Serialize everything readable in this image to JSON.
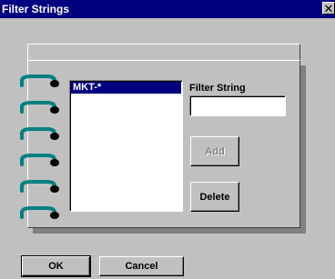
{
  "window": {
    "title": "Filter Strings",
    "close_glyph": "✕"
  },
  "filter_list": {
    "items": [
      "MKT-*"
    ],
    "selected_index": 0
  },
  "filter_string": {
    "label": "Filter String",
    "value": "",
    "placeholder": ""
  },
  "buttons": {
    "add": {
      "label": "Add",
      "enabled": false
    },
    "delete": {
      "label": "Delete",
      "enabled": true
    },
    "ok": {
      "label": "OK"
    },
    "cancel": {
      "label": "Cancel"
    }
  },
  "colors": {
    "titlebar": "#000080",
    "face": "#c0c0c0",
    "selection": "#000080",
    "ring": "#008080"
  }
}
